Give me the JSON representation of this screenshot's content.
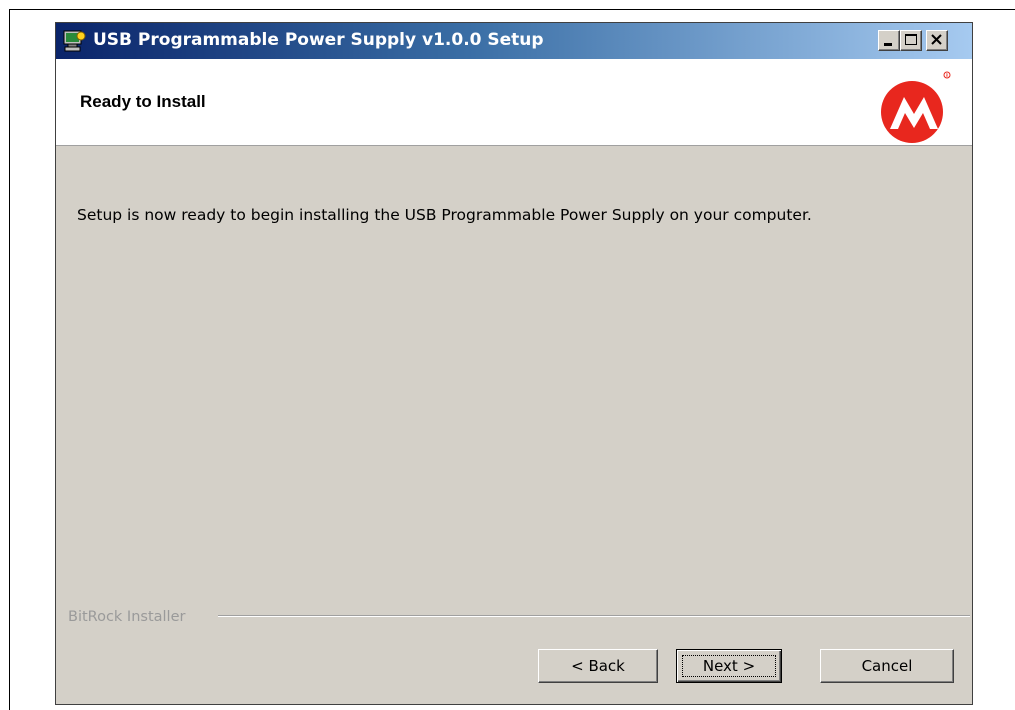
{
  "window": {
    "title": "USB Programmable Power Supply v1.0.0 Setup",
    "controls": {
      "minimize": "minimize",
      "maximize": "maximize",
      "close": "close"
    }
  },
  "header": {
    "title": "Ready to Install",
    "logo_icon": "microchip-logo-icon",
    "logo_color": "#e8271e"
  },
  "content": {
    "message": "Setup is now ready to begin installing the USB Programmable Power Supply on your computer."
  },
  "footer": {
    "brand": "BitRock Installer"
  },
  "buttons": {
    "back": "< Back",
    "next": "Next >",
    "cancel": "Cancel"
  }
}
